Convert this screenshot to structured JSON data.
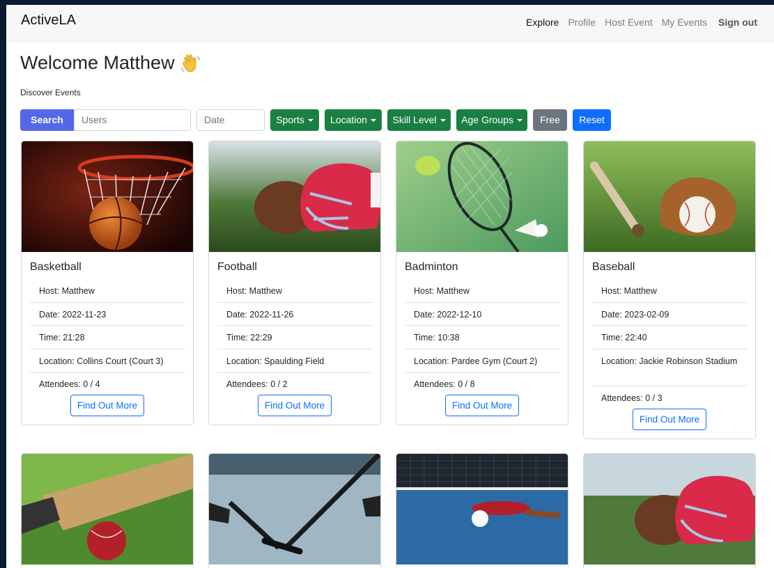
{
  "navbar": {
    "brand": "ActiveLA",
    "links": [
      "Explore",
      "Profile",
      "Host Event",
      "My Events"
    ],
    "signout": "Sign out"
  },
  "welcome": "Welcome Matthew",
  "subtitle": "Discover Events",
  "filters": {
    "search_label": "Search",
    "users_placeholder": "Users",
    "date_placeholder": "Date",
    "sports": "Sports",
    "location": "Location",
    "skill": "Skill Level",
    "age": "Age Groups",
    "free": "Free",
    "reset": "Reset"
  },
  "events": [
    {
      "title": "Basketball",
      "host": "Host: Matthew",
      "date": "Date: 2022-11-23",
      "time": "Time: 21:28",
      "location": "Location: Collins Court (Court 3)",
      "attendees": "Attendees: 0 / 4",
      "button": "Find Out More"
    },
    {
      "title": "Football",
      "host": "Host: Matthew",
      "date": "Date: 2022-11-26",
      "time": "Time: 22:29",
      "location": "Location: Spaulding Field",
      "attendees": "Attendees: 0 / 2",
      "button": "Find Out More"
    },
    {
      "title": "Badminton",
      "host": "Host: Matthew",
      "date": "Date: 2022-12-10",
      "time": "Time: 10:38",
      "location": "Location: Pardee Gym (Court 2)",
      "attendees": "Attendees: 0 / 8",
      "button": "Find Out More"
    },
    {
      "title": "Baseball",
      "host": "Host: Matthew",
      "date": "Date: 2023-02-09",
      "time": "Time: 22:40",
      "location": "Location: Jackie Robinson Stadium",
      "attendees": "Attendees: 0 / 3",
      "button": "Find Out More"
    }
  ],
  "colors": {
    "search": "#5468e7",
    "filter_green": "#1a7f43",
    "free_gray": "#6c757d",
    "reset_blue": "#0d6efd"
  }
}
